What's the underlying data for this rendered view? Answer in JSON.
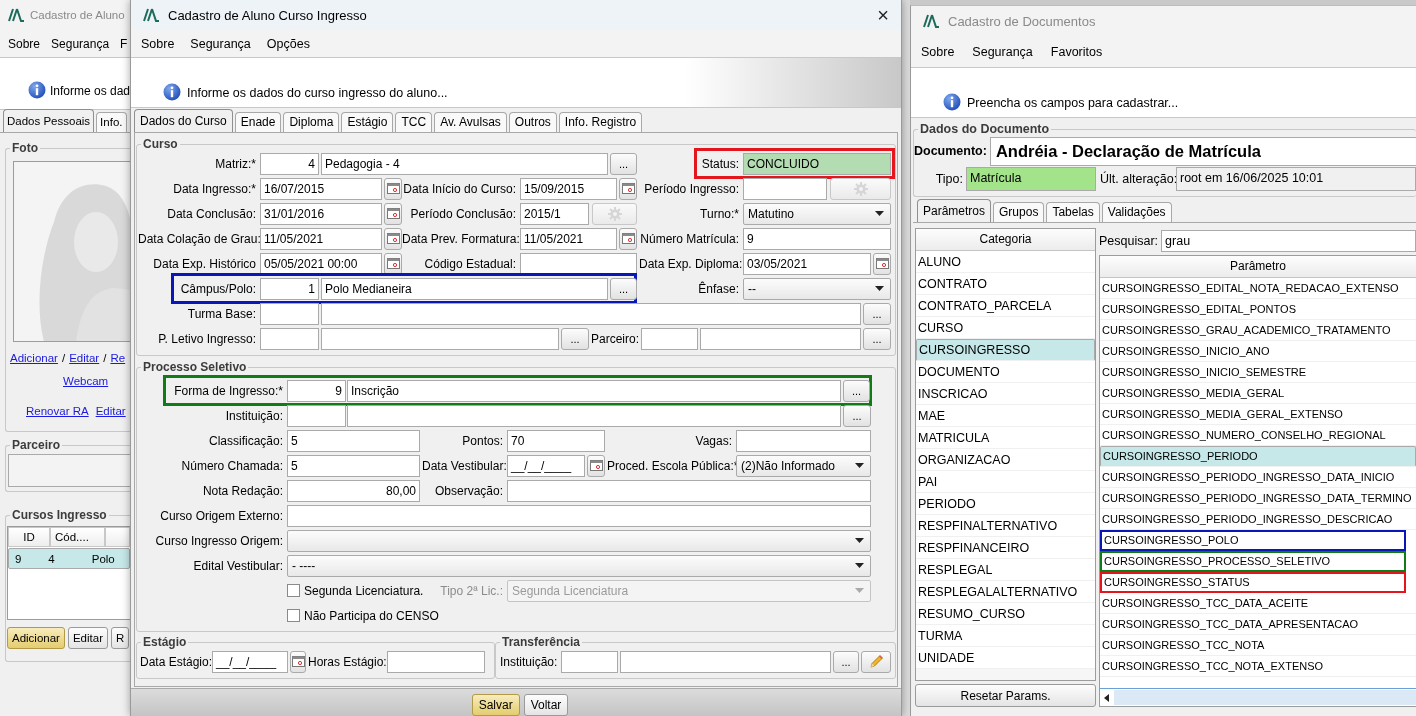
{
  "back_window": {
    "title": "Cadastro de Aluno",
    "menu": [
      "Sobre",
      "Segurança",
      "F"
    ],
    "info": "Informe os dad",
    "tabs": [
      {
        "label": "Dados Pessoais",
        "selected": true
      },
      {
        "label": "Info.",
        "selected": false
      }
    ],
    "photo_group": {
      "title": "Foto",
      "links": [
        {
          "kind": "link",
          "text": "Adicionar"
        },
        {
          "kind": "sep",
          "text": "/"
        },
        {
          "kind": "link",
          "text": "Editar"
        },
        {
          "kind": "sep",
          "text": "/"
        },
        {
          "kind": "link",
          "text": "Re"
        }
      ],
      "webcam_link": "Webcam",
      "bottom_links": [
        "Renovar RA",
        "Editar"
      ]
    },
    "partner_group": {
      "title": "Parceiro"
    },
    "courses_group": {
      "title": "Cursos Ingresso",
      "columns": [
        "ID",
        "Cód...."
      ],
      "rows": [
        {
          "cells": [
            "9",
            "4",
            "Polo"
          ],
          "selected": true
        }
      ],
      "buttons": [
        {
          "label": "Adicionar",
          "primary": true
        },
        {
          "label": "Editar",
          "primary": false
        },
        {
          "label": "R",
          "primary": false
        }
      ]
    }
  },
  "main_window": {
    "title": "Cadastro de Aluno Curso Ingresso",
    "close": "×",
    "menu": [
      "Sobre",
      "Segurança",
      "Opções"
    ],
    "info": "Informe os dados do curso ingresso do aluno...",
    "tabs": [
      {
        "label": "Dados do Curso",
        "selected": true
      },
      {
        "label": "Enade",
        "selected": false
      },
      {
        "label": "Diploma",
        "selected": false
      },
      {
        "label": "Estágio",
        "selected": false
      },
      {
        "label": "TCC",
        "selected": false
      },
      {
        "label": "Av. Avulsas",
        "selected": false
      },
      {
        "label": "Outros",
        "selected": false
      },
      {
        "label": "Info. Registro",
        "selected": false
      }
    ],
    "curso": {
      "title": "Curso",
      "lines": [
        {
          "items": [
            {
              "kind": "label",
              "text": "Matriz:*"
            },
            {
              "kind": "number_field",
              "value": "4"
            },
            {
              "kind": "field",
              "value": "Pedagogia - 4"
            },
            {
              "kind": "dots_button",
              "text": "..."
            },
            {
              "kind": "box",
              "color": "#e3161d",
              "items": [
                {
                  "kind": "label",
                  "text": "Status:"
                },
                {
                  "kind": "field",
                  "value": "CONCLUIDO",
                  "highlighted": true
                }
              ]
            }
          ]
        },
        {
          "items": [
            {
              "kind": "label",
              "text": "Data Ingresso:*"
            },
            {
              "kind": "field",
              "value": "16/07/2015"
            },
            {
              "kind": "calendar_button"
            },
            {
              "kind": "label",
              "text": "Data Início do Curso:"
            },
            {
              "kind": "field",
              "value": "15/09/2015"
            },
            {
              "kind": "calendar_button"
            },
            {
              "kind": "label",
              "text": "Período Ingresso:"
            },
            {
              "kind": "field"
            },
            {
              "kind": "gear_button",
              "disabled": true
            }
          ]
        },
        {
          "items": [
            {
              "kind": "label",
              "text": "Data Conclusão:"
            },
            {
              "kind": "field",
              "value": "31/01/2016"
            },
            {
              "kind": "calendar_button"
            },
            {
              "kind": "label",
              "text": "Período Conclusão:"
            },
            {
              "kind": "field",
              "value": "2015/1"
            },
            {
              "kind": "gear_button",
              "disabled": true
            },
            {
              "kind": "label",
              "text": "Turno:*"
            },
            {
              "kind": "select",
              "value": "Matutino",
              "disabled": false
            }
          ]
        },
        {
          "items": [
            {
              "kind": "label",
              "text": "Data Colação de Grau:"
            },
            {
              "kind": "field",
              "value": "11/05/2021"
            },
            {
              "kind": "calendar_button"
            },
            {
              "kind": "label",
              "text": "Data Prev. Formatura:"
            },
            {
              "kind": "field",
              "value": "11/05/2021"
            },
            {
              "kind": "calendar_button"
            },
            {
              "kind": "label",
              "text": "Número Matrícula:"
            },
            {
              "kind": "field",
              "value": "9"
            }
          ]
        },
        {
          "items": [
            {
              "kind": "label",
              "text": "Data Exp. Histórico"
            },
            {
              "kind": "field",
              "value": "05/05/2021 00:00"
            },
            {
              "kind": "calendar_button"
            },
            {
              "kind": "label",
              "text": "Código Estadual:"
            },
            {
              "kind": "field"
            },
            {
              "kind": "label",
              "text": "Data Exp. Diploma:"
            },
            {
              "kind": "field",
              "value": "03/05/2021"
            },
            {
              "kind": "calendar_button"
            }
          ]
        },
        {
          "items": [
            {
              "kind": "box",
              "color": "#0a17b8",
              "items": [
                {
                  "kind": "label",
                  "text": "Câmpus/Polo:"
                },
                {
                  "kind": "number_field",
                  "value": "1"
                },
                {
                  "kind": "field",
                  "value": "Polo Medianeira"
                },
                {
                  "kind": "dots_button",
                  "text": "..."
                }
              ]
            },
            {
              "kind": "label",
              "text": "Ênfase:"
            },
            {
              "kind": "select",
              "value": "--",
              "disabled": false
            }
          ]
        },
        {
          "items": [
            {
              "kind": "label",
              "text": "Turma Base:"
            },
            {
              "kind": "number_field"
            },
            {
              "kind": "field"
            },
            {
              "kind": "dots_button",
              "text": "..."
            }
          ]
        },
        {
          "items": [
            {
              "kind": "label",
              "text": "P. Letivo Ingresso:"
            },
            {
              "kind": "number_field"
            },
            {
              "kind": "field"
            },
            {
              "kind": "dots_button",
              "text": "..."
            },
            {
              "kind": "label",
              "text": "Parceiro:"
            },
            {
              "kind": "number_field"
            },
            {
              "kind": "field"
            },
            {
              "kind": "dots_button",
              "text": "..."
            }
          ]
        }
      ]
    },
    "processo": {
      "title": "Processo Seletivo",
      "lines": [
        {
          "items": [
            {
              "kind": "box",
              "color": "#137a18",
              "items": [
                {
                  "kind": "label",
                  "text": "Forma de Ingresso:*"
                },
                {
                  "kind": "number_field",
                  "value": "9"
                },
                {
                  "kind": "field",
                  "value": "Inscrição"
                },
                {
                  "kind": "dots_button",
                  "text": "..."
                }
              ]
            }
          ]
        },
        {
          "items": [
            {
              "kind": "label",
              "text": "Instituição:"
            },
            {
              "kind": "number_field"
            },
            {
              "kind": "field"
            },
            {
              "kind": "dots_button",
              "text": "..."
            }
          ]
        },
        {
          "items": [
            {
              "kind": "label",
              "text": "Classificação:"
            },
            {
              "kind": "field",
              "value": "5"
            },
            {
              "kind": "label",
              "text": "Pontos:"
            },
            {
              "kind": "field",
              "value": "70"
            },
            {
              "kind": "label",
              "text": "Vagas:"
            },
            {
              "kind": "field"
            }
          ]
        },
        {
          "items": [
            {
              "kind": "label",
              "text": "Número Chamada:"
            },
            {
              "kind": "field",
              "value": "5"
            },
            {
              "kind": "label",
              "text": "Data Vestibular:"
            },
            {
              "kind": "field",
              "value": "__/__/____"
            },
            {
              "kind": "calendar_button"
            },
            {
              "kind": "label",
              "text": "Proced. Escola Pública:*"
            },
            {
              "kind": "select",
              "value": "(2)Não Informado",
              "disabled": false
            }
          ]
        },
        {
          "items": [
            {
              "kind": "label",
              "text": "Nota Redação:"
            },
            {
              "kind": "number_field",
              "value": "80,00"
            },
            {
              "kind": "label",
              "text": "Observação:"
            },
            {
              "kind": "field"
            }
          ]
        },
        {
          "items": [
            {
              "kind": "label",
              "text": "Curso Origem Externo:"
            },
            {
              "kind": "field"
            }
          ]
        },
        {
          "items": [
            {
              "kind": "label",
              "text": "Curso Ingresso Origem:"
            },
            {
              "kind": "select",
              "disabled": false
            }
          ]
        },
        {
          "items": [
            {
              "kind": "label",
              "text": "Edital Vestibular:"
            },
            {
              "kind": "select",
              "value": "- ----",
              "disabled": false
            }
          ]
        },
        {
          "items": [
            {
              "kind": "checkbox",
              "label": "Segunda Licenciatura.",
              "checked": false
            },
            {
              "kind": "label",
              "text": "Tipo 2ª Lic.:",
              "disabled": true
            },
            {
              "kind": "select",
              "value": "Segunda Licenciatura",
              "disabled": true
            }
          ]
        },
        {
          "items": [
            {
              "kind": "checkbox",
              "label": "Não Participa do CENSO",
              "checked": false
            }
          ]
        }
      ]
    },
    "estagio": {
      "title": "Estágio",
      "items": [
        {
          "kind": "label",
          "text": "Data Estágio:"
        },
        {
          "kind": "field",
          "value": "__/__/____"
        },
        {
          "kind": "calendar_button"
        },
        {
          "kind": "label",
          "text": "Horas Estágio:"
        },
        {
          "kind": "field"
        }
      ]
    },
    "transferencia": {
      "title": "Transferência",
      "items": [
        {
          "kind": "label",
          "text": "Instituição:"
        },
        {
          "kind": "number_field"
        },
        {
          "kind": "field"
        },
        {
          "kind": "dots_button",
          "text": "..."
        },
        {
          "kind": "pencil_button"
        }
      ]
    },
    "buttons": [
      {
        "label": "Salvar",
        "primary": true
      },
      {
        "label": "Voltar",
        "primary": false
      }
    ]
  },
  "documents_window": {
    "title": "Cadastro de Documentos",
    "menu": [
      "Sobre",
      "Segurança",
      "Favoritos"
    ],
    "info": "Preencha os campos para cadastrar...",
    "group_title": "Dados do Documento",
    "document_label": "Documento:",
    "document_value": "Andréia - Declaração de Matrícula",
    "type_label": "Tipo:",
    "type_value": "Matrícula",
    "changed_label": "Últ. alteração:",
    "changed_value": "root em 16/06/2025 10:01",
    "tabs": [
      {
        "label": "Parâmetros",
        "selected": true
      },
      {
        "label": "Grupos",
        "selected": false
      },
      {
        "label": "Tabelas",
        "selected": false
      },
      {
        "label": "Validações",
        "selected": false
      }
    ],
    "category_header": "Categoria",
    "categories": [
      {
        "name": "ALUNO",
        "selected": false
      },
      {
        "name": "CONTRATO",
        "selected": false
      },
      {
        "name": "CONTRATO_PARCELA",
        "selected": false
      },
      {
        "name": "CURSO",
        "selected": false
      },
      {
        "name": "CURSOINGRESSO",
        "selected": true
      },
      {
        "name": "DOCUMENTO",
        "selected": false
      },
      {
        "name": "INSCRICAO",
        "selected": false
      },
      {
        "name": "MAE",
        "selected": false
      },
      {
        "name": "MATRICULA",
        "selected": false
      },
      {
        "name": "ORGANIZACAO",
        "selected": false
      },
      {
        "name": "PAI",
        "selected": false
      },
      {
        "name": "PERIODO",
        "selected": false
      },
      {
        "name": "RESPFINALTERNATIVO",
        "selected": false
      },
      {
        "name": "RESPFINANCEIRO",
        "selected": false
      },
      {
        "name": "RESPLEGAL",
        "selected": false
      },
      {
        "name": "RESPLEGALALTERNATIVO",
        "selected": false
      },
      {
        "name": "RESUMO_CURSO",
        "selected": false
      },
      {
        "name": "TURMA",
        "selected": false
      },
      {
        "name": "UNIDADE",
        "selected": false
      }
    ],
    "reset_button": "Resetar Params.",
    "search_label": "Pesquisar:",
    "search_value": "grau",
    "parameter_header": "Parâmetro",
    "parameters": [
      {
        "name": "CURSOINGRESSO_EDITAL_NOTA_REDACAO_EXTENSO",
        "selected": false
      },
      {
        "name": "CURSOINGRESSO_EDITAL_PONTOS",
        "selected": false
      },
      {
        "name": "CURSOINGRESSO_GRAU_ACADEMICO_TRATAMENTO",
        "selected": false
      },
      {
        "name": "CURSOINGRESSO_INICIO_ANO",
        "selected": false
      },
      {
        "name": "CURSOINGRESSO_INICIO_SEMESTRE",
        "selected": false
      },
      {
        "name": "CURSOINGRESSO_MEDIA_GERAL",
        "selected": false
      },
      {
        "name": "CURSOINGRESSO_MEDIA_GERAL_EXTENSO",
        "selected": false
      },
      {
        "name": "CURSOINGRESSO_NUMERO_CONSELHO_REGIONAL",
        "selected": false
      },
      {
        "name": "CURSOINGRESSO_PERIODO",
        "selected": true
      },
      {
        "name": "CURSOINGRESSO_PERIODO_INGRESSO_DATA_INICIO",
        "selected": false
      },
      {
        "name": "CURSOINGRESSO_PERIODO_INGRESSO_DATA_TERMINO",
        "selected": false
      },
      {
        "name": "CURSOINGRESSO_PERIODO_INGRESSO_DESCRICAO",
        "selected": false
      },
      {
        "name": "CURSOINGRESSO_POLO",
        "selected": false,
        "color": "#0a17b8"
      },
      {
        "name": "CURSOINGRESSO_PROCESSO_SELETIVO",
        "selected": false,
        "color": "#137a18"
      },
      {
        "name": "CURSOINGRESSO_STATUS",
        "selected": false,
        "color": "#e3161d"
      },
      {
        "name": "CURSOINGRESSO_TCC_DATA_ACEITE",
        "selected": false
      },
      {
        "name": "CURSOINGRESSO_TCC_DATA_APRESENTACAO",
        "selected": false
      },
      {
        "name": "CURSOINGRESSO_TCC_NOTA",
        "selected": false
      },
      {
        "name": "CURSOINGRESSO_TCC_NOTA_EXTENSO",
        "selected": false
      }
    ]
  }
}
